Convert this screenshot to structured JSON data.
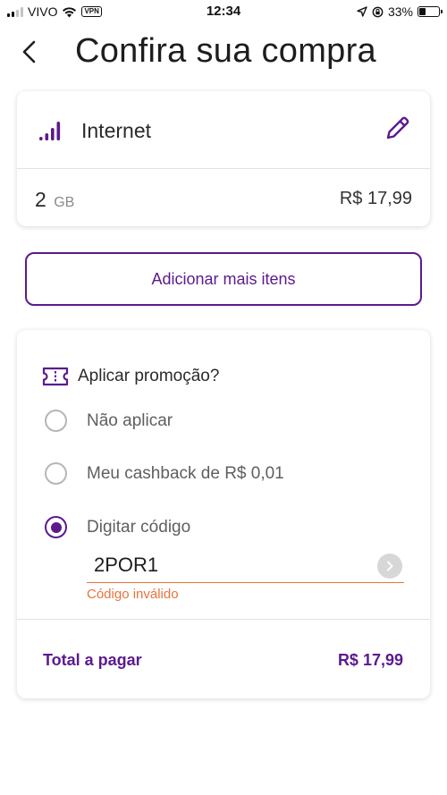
{
  "status_bar": {
    "carrier": "VIVO",
    "vpn": "VPN",
    "time": "12:34",
    "battery": "33%",
    "battery_level": 0.33
  },
  "header": {
    "title": "Confira sua compra",
    "back_icon": "chevron-left-icon"
  },
  "product": {
    "icon": "signal-bars-icon",
    "name": "Internet",
    "edit_icon": "pencil-icon",
    "quantity": "2",
    "unit": "GB",
    "price": "R$ 17,99"
  },
  "add_more_label": "Adicionar mais itens",
  "promo": {
    "icon": "ticket-icon",
    "title": "Aplicar promoção?",
    "options": [
      {
        "label": "Não aplicar",
        "selected": false
      },
      {
        "label": "Meu cashback de R$ 0,01",
        "selected": false
      },
      {
        "label": "Digitar código",
        "selected": true
      }
    ],
    "code_value": "2POR1",
    "error": "Código inválido"
  },
  "total": {
    "label": "Total a pagar",
    "value": "R$ 17,99"
  },
  "colors": {
    "primary": "#5c1a8e",
    "error": "#e8743b"
  }
}
